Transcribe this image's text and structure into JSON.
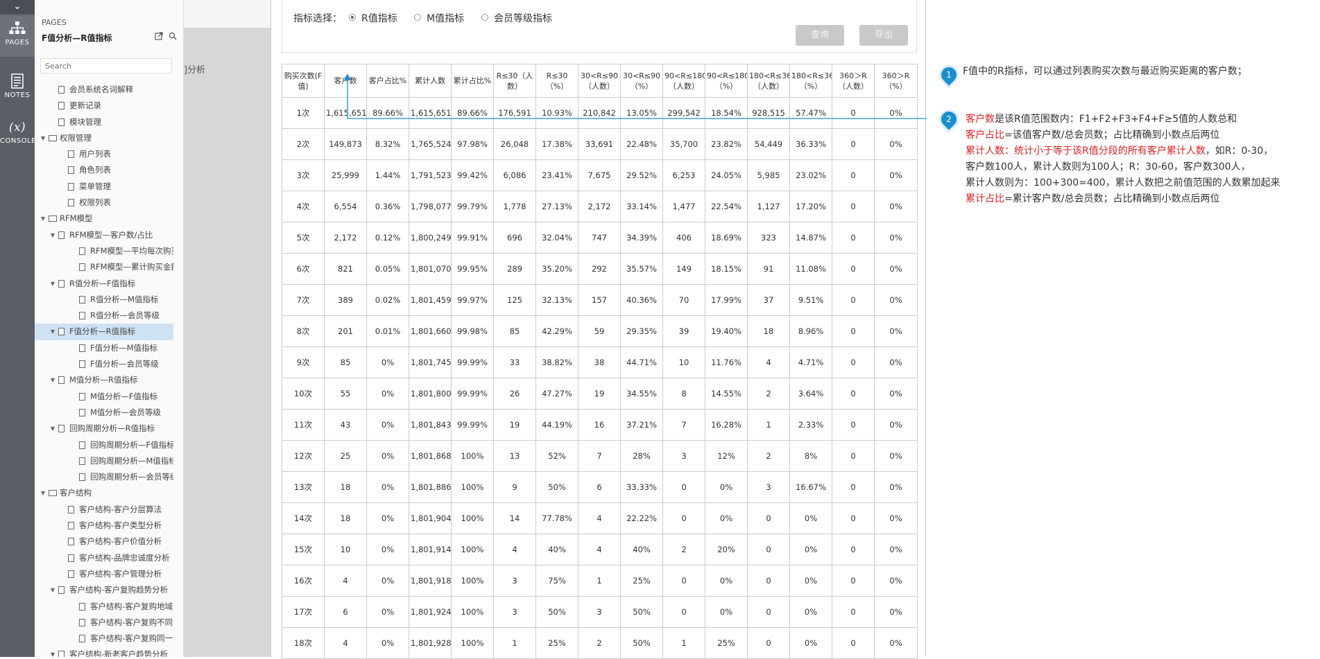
{
  "rail": {
    "pages_label": "PAGES",
    "notes_label": "NOTES",
    "console_label": "CONSOLE",
    "console_icon": "(x)"
  },
  "pages_panel": {
    "section_label": "PAGES",
    "current_page": "F值分析—R值指标",
    "search_placeholder": "Search",
    "tree": [
      {
        "level": 1,
        "type": "file",
        "label": "会员系统名词解释"
      },
      {
        "level": 1,
        "type": "file",
        "label": "更新记录"
      },
      {
        "level": 1,
        "type": "file",
        "label": "模块管理"
      },
      {
        "level": 0,
        "type": "folder",
        "label": "权限管理"
      },
      {
        "level": 2,
        "type": "file",
        "label": "用户列表"
      },
      {
        "level": 2,
        "type": "file",
        "label": "角色列表"
      },
      {
        "level": 2,
        "type": "file",
        "label": "菜单管理"
      },
      {
        "level": 2,
        "type": "file",
        "label": "权限列表"
      },
      {
        "level": 0,
        "type": "folder",
        "label": "RFM模型"
      },
      {
        "level": 1,
        "type": "file-expand",
        "label": "RFM模型—客户数/占比"
      },
      {
        "level": 3,
        "type": "file",
        "label": "RFM模型—平均每次购买"
      },
      {
        "level": 3,
        "type": "file",
        "label": "RFM模型—累计购买金额"
      },
      {
        "level": 1,
        "type": "file-expand",
        "label": "R值分析—F值指标"
      },
      {
        "level": 3,
        "type": "file",
        "label": "R值分析—M值指标"
      },
      {
        "level": 3,
        "type": "file",
        "label": "R值分析—会员等级"
      },
      {
        "level": 1,
        "type": "file-expand",
        "label": "F值分析—R值指标",
        "selected": true
      },
      {
        "level": 3,
        "type": "file",
        "label": "F值分析—M值指标"
      },
      {
        "level": 3,
        "type": "file",
        "label": "F值分析—会员等级"
      },
      {
        "level": 1,
        "type": "file-expand",
        "label": "M值分析—R值指标"
      },
      {
        "level": 3,
        "type": "file",
        "label": "M值分析—F值指标"
      },
      {
        "level": 3,
        "type": "file",
        "label": "M值分析—会员等级"
      },
      {
        "level": 1,
        "type": "file-expand",
        "label": "回购周期分析—R值指标"
      },
      {
        "level": 3,
        "type": "file",
        "label": "回购周期分析—F值指标"
      },
      {
        "level": 3,
        "type": "file",
        "label": "回购周期分析—M值指标"
      },
      {
        "level": 3,
        "type": "file",
        "label": "回购周期分析—会员等级"
      },
      {
        "level": 0,
        "type": "folder",
        "label": "客户结构"
      },
      {
        "level": 2,
        "type": "file",
        "label": "客户结构-客户分层算法"
      },
      {
        "level": 2,
        "type": "file",
        "label": "客户结构-客户类型分析"
      },
      {
        "level": 2,
        "type": "file",
        "label": "客户结构-客户价值分析"
      },
      {
        "level": 2,
        "type": "file",
        "label": "客户结构-品牌忠诚度分析"
      },
      {
        "level": 2,
        "type": "file",
        "label": "客户结构-客户管理分析"
      },
      {
        "level": 1,
        "type": "file-expand",
        "label": "客户结构-客户复购趋势分析"
      },
      {
        "level": 3,
        "type": "file",
        "label": "客户结构-客户复购地域"
      },
      {
        "level": 3,
        "type": "file",
        "label": "客户结构-客户复购不同"
      },
      {
        "level": 3,
        "type": "file",
        "label": "客户结构-客户复购同一"
      },
      {
        "level": 1,
        "type": "file-expand",
        "label": "客户结构-新老客户趋势分析"
      }
    ]
  },
  "strip": {
    "partial_text": "]分析"
  },
  "filter": {
    "label": "指标选择：",
    "options": [
      {
        "label": "R值指标",
        "selected": true
      },
      {
        "label": "M值指标",
        "selected": false
      },
      {
        "label": "会员等级指标",
        "selected": false
      }
    ],
    "query_button": "查询",
    "export_button": "导出"
  },
  "table": {
    "headers": [
      "购买次数(F值)",
      "客户数",
      "客户占比%",
      "累计人数",
      "累计占比%",
      "R≤30（人数）",
      "R≤30（%）",
      "30<R≤90（人数）",
      "30<R≤90（%）",
      "90<R≤180（人数）",
      "90<R≤180（%）",
      "180<R≤360（人数）",
      "180<R≤360（%）",
      "360＞R（人数）",
      "360＞R（%）"
    ],
    "rows": [
      [
        "1次",
        "1,615,651",
        "89.66%",
        "1,615,651",
        "89.66%",
        "176,591",
        "10.93%",
        "210,842",
        "13.05%",
        "299,542",
        "18.54%",
        "928,515",
        "57.47%",
        "0",
        "0%"
      ],
      [
        "2次",
        "149,873",
        "8.32%",
        "1,765,524",
        "97.98%",
        "26,048",
        "17.38%",
        "33,691",
        "22.48%",
        "35,700",
        "23.82%",
        "54,449",
        "36.33%",
        "0",
        "0%"
      ],
      [
        "3次",
        "25,999",
        "1.44%",
        "1,791,523",
        "99.42%",
        "6,086",
        "23.41%",
        "7,675",
        "29.52%",
        "6,253",
        "24.05%",
        "5,985",
        "23.02%",
        "0",
        "0%"
      ],
      [
        "4次",
        "6,554",
        "0.36%",
        "1,798,077",
        "99.79%",
        "1,778",
        "27.13%",
        "2,172",
        "33.14%",
        "1,477",
        "22.54%",
        "1,127",
        "17.20%",
        "0",
        "0%"
      ],
      [
        "5次",
        "2,172",
        "0.12%",
        "1,800,249",
        "99.91%",
        "696",
        "32.04%",
        "747",
        "34.39%",
        "406",
        "18.69%",
        "323",
        "14.87%",
        "0",
        "0%"
      ],
      [
        "6次",
        "821",
        "0.05%",
        "1,801,070",
        "99.95%",
        "289",
        "35.20%",
        "292",
        "35.57%",
        "149",
        "18.15%",
        "91",
        "11.08%",
        "0",
        "0%"
      ],
      [
        "7次",
        "389",
        "0.02%",
        "1,801,459",
        "99.97%",
        "125",
        "32.13%",
        "157",
        "40.36%",
        "70",
        "17.99%",
        "37",
        "9.51%",
        "0",
        "0%"
      ],
      [
        "8次",
        "201",
        "0.01%",
        "1,801,660",
        "99.98%",
        "85",
        "42.29%",
        "59",
        "29.35%",
        "39",
        "19.40%",
        "18",
        "8.96%",
        "0",
        "0%"
      ],
      [
        "9次",
        "85",
        "0%",
        "1,801,745",
        "99.99%",
        "33",
        "38.82%",
        "38",
        "44.71%",
        "10",
        "11.76%",
        "4",
        "4.71%",
        "0",
        "0%"
      ],
      [
        "10次",
        "55",
        "0%",
        "1,801,800",
        "99.99%",
        "26",
        "47.27%",
        "19",
        "34.55%",
        "8",
        "14.55%",
        "2",
        "3.64%",
        "0",
        "0%"
      ],
      [
        "11次",
        "43",
        "0%",
        "1,801,843",
        "99.99%",
        "19",
        "44.19%",
        "16",
        "37.21%",
        "7",
        "16.28%",
        "1",
        "2.33%",
        "0",
        "0%"
      ],
      [
        "12次",
        "25",
        "0%",
        "1,801,868",
        "100%",
        "13",
        "52%",
        "7",
        "28%",
        "3",
        "12%",
        "2",
        "8%",
        "0",
        "0%"
      ],
      [
        "13次",
        "18",
        "0%",
        "1,801,886",
        "100%",
        "9",
        "50%",
        "6",
        "33.33%",
        "0",
        "0%",
        "3",
        "16.67%",
        "0",
        "0%"
      ],
      [
        "14次",
        "18",
        "0%",
        "1,801,904",
        "100%",
        "14",
        "77.78%",
        "4",
        "22.22%",
        "0",
        "0%",
        "0",
        "0%",
        "0",
        "0%"
      ],
      [
        "15次",
        "10",
        "0%",
        "1,801,914",
        "100%",
        "4",
        "40%",
        "4",
        "40%",
        "2",
        "20%",
        "0",
        "0%",
        "0",
        "0%"
      ],
      [
        "16次",
        "4",
        "0%",
        "1,801,918",
        "100%",
        "3",
        "75%",
        "1",
        "25%",
        "0",
        "0%",
        "0",
        "0%",
        "0",
        "0%"
      ],
      [
        "17次",
        "6",
        "0%",
        "1,801,924",
        "100%",
        "3",
        "50%",
        "3",
        "50%",
        "0",
        "0%",
        "0",
        "0%",
        "0",
        "0%"
      ],
      [
        "18次",
        "4",
        "0%",
        "1,801,928",
        "100%",
        "1",
        "25%",
        "2",
        "50%",
        "1",
        "25%",
        "0",
        "0%",
        "0",
        "0%"
      ]
    ]
  },
  "notes": {
    "badge1": "1",
    "note1": "F值中的R指标，可以通过列表购买次数与最近购买距离的客户数；",
    "badge2": "2",
    "lines": [
      {
        "red": "客户数",
        "black": "是该R值范围数内：F1+F2+F3+F4+F≥5值的人数总和"
      },
      {
        "red": "客户占比",
        "black": "=该值客户数/总会员数；占比精确到小数点后两位"
      },
      {
        "red": "累计人数：统计小于等于该R值分段的所有客户累计人数",
        "black": "，如R：0-30，"
      },
      {
        "red": "",
        "black": "客户数100人，累计人数则为100人；R：30-60，客户数300人，"
      },
      {
        "red": "",
        "black": "累计人数则为：100+300=400，累计人数把之前值范围的人数累加起来"
      },
      {
        "red": "累计占比",
        "black": "=累计客户数/总会员数；占比精确到小数点后两位"
      }
    ],
    "accent_color": "#1b8fce",
    "highlight_color": "#e02020"
  }
}
